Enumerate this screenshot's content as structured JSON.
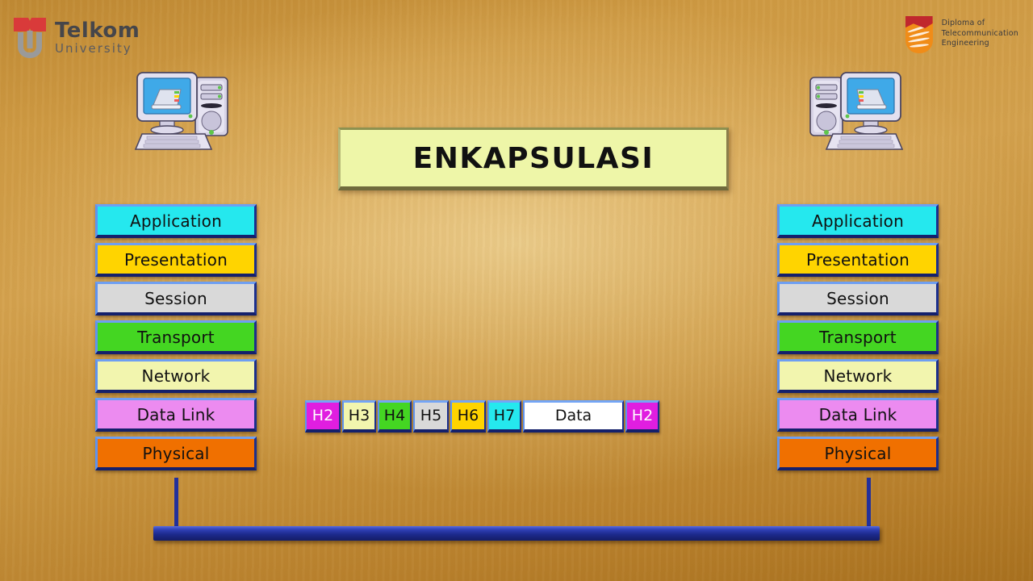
{
  "slide": {
    "title": "ENKAPSULASI",
    "background_color": "#c9953f"
  },
  "branding": {
    "telkom": {
      "name": "Telkom",
      "sub": "University",
      "mark_icon": "telkom-u-logo-icon",
      "red": "#d93a3a",
      "gray": "#9a9a9a"
    },
    "diploma": {
      "line1": "Diploma of",
      "line2": "Telecommunication",
      "line3": "Engineering",
      "mark_icon": "diploma-shield-logo-icon",
      "orange": "#f08c18",
      "red": "#c0272d"
    }
  },
  "devices": [
    {
      "name": "computer-left",
      "icon": "desktop-computer-icon"
    },
    {
      "name": "computer-right",
      "icon": "desktop-computer-icon"
    }
  ],
  "osi_stack_left": {
    "layers": [
      {
        "label": "Application",
        "color": "#25e8ee",
        "text_color": "#111111"
      },
      {
        "label": "Presentation",
        "color": "#ffd400",
        "text_color": "#111111"
      },
      {
        "label": "Session",
        "color": "#d9d9d9",
        "text_color": "#111111"
      },
      {
        "label": "Transport",
        "color": "#44d622",
        "text_color": "#111111"
      },
      {
        "label": "Network",
        "color": "#f2f5ae",
        "text_color": "#111111"
      },
      {
        "label": "Data Link",
        "color": "#ec8bf0",
        "text_color": "#111111"
      },
      {
        "label": "Physical",
        "color": "#f07000",
        "text_color": "#111111"
      }
    ]
  },
  "osi_stack_right": {
    "layers": [
      {
        "label": "Application",
        "color": "#25e8ee",
        "text_color": "#111111"
      },
      {
        "label": "Presentation",
        "color": "#ffd400",
        "text_color": "#111111"
      },
      {
        "label": "Session",
        "color": "#d9d9d9",
        "text_color": "#111111"
      },
      {
        "label": "Transport",
        "color": "#44d622",
        "text_color": "#111111"
      },
      {
        "label": "Network",
        "color": "#f2f5ae",
        "text_color": "#111111"
      },
      {
        "label": "Data Link",
        "color": "#ec8bf0",
        "text_color": "#111111"
      },
      {
        "label": "Physical",
        "color": "#f07000",
        "text_color": "#111111"
      }
    ]
  },
  "packet": {
    "fields": [
      {
        "label": "H2",
        "color": "#e01ee0",
        "text_color": "#ffffff",
        "width": 44
      },
      {
        "label": "H3",
        "color": "#f2f5ae",
        "text_color": "#111111",
        "width": 42
      },
      {
        "label": "H4",
        "color": "#44d622",
        "text_color": "#111111",
        "width": 42
      },
      {
        "label": "H5",
        "color": "#d9d9d9",
        "text_color": "#111111",
        "width": 44
      },
      {
        "label": "H6",
        "color": "#ffd400",
        "text_color": "#111111",
        "width": 44
      },
      {
        "label": "H7",
        "color": "#25e8ee",
        "text_color": "#111111",
        "width": 42
      },
      {
        "label": "Data",
        "color": "#ffffff",
        "text_color": "#111111",
        "width": 125
      },
      {
        "label": "H2",
        "color": "#e01ee0",
        "text_color": "#ffffff",
        "width": 42
      }
    ]
  },
  "network": {
    "bus_color": "#23309b",
    "bus_label": "network-bus"
  }
}
